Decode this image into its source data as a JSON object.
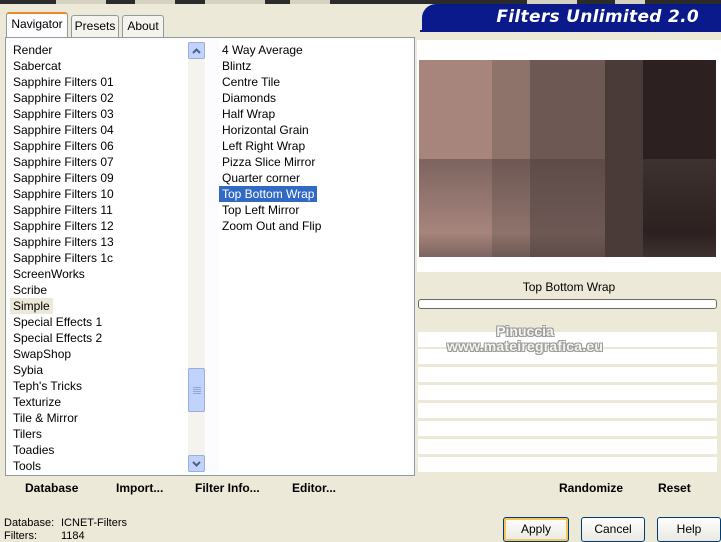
{
  "window": {
    "title": "Filters Unlimited 2.0"
  },
  "tabs": [
    {
      "label": "Navigator",
      "active": true
    },
    {
      "label": "Presets",
      "active": false
    },
    {
      "label": "About",
      "active": false
    }
  ],
  "categories": {
    "items": [
      "Render",
      "Sabercat",
      "Sapphire Filters 01",
      "Sapphire Filters 02",
      "Sapphire Filters 03",
      "Sapphire Filters 04",
      "Sapphire Filters 06",
      "Sapphire Filters 07",
      "Sapphire Filters 09",
      "Sapphire Filters 10",
      "Sapphire Filters 11",
      "Sapphire Filters 12",
      "Sapphire Filters 13",
      "Sapphire Filters 1c",
      "ScreenWorks",
      "Scribe",
      "Simple",
      "Special Effects 1",
      "Special Effects 2",
      "SwapShop",
      "Sybia",
      "Teph's Tricks",
      "Texturize",
      "Tile & Mirror",
      "Tilers",
      "Toadies",
      "Tools"
    ],
    "selected": "Simple"
  },
  "filters": {
    "items": [
      "4 Way Average",
      "Blintz",
      "Centre Tile",
      "Diamonds",
      "Half Wrap",
      "Horizontal Grain",
      "Left Right Wrap",
      "Pizza Slice Mirror",
      "Quarter corner",
      "Top Bottom Wrap",
      "Top Left Mirror",
      "Zoom Out and Flip"
    ],
    "selected": "Top Bottom Wrap"
  },
  "preview": {
    "filter_name": "Top Bottom Wrap",
    "colors": {
      "c1": "#a7857c",
      "c2": "#8e736b",
      "c3": "#6d5854",
      "c4": "#4a3a38",
      "c5": "#2c2020",
      "r2c1": "#7c6460",
      "r2c2": "#6e5854",
      "r2c3": "#5e4b48",
      "r2c4": "#4a3b39",
      "r2c5": "#3e3230"
    }
  },
  "watermark": {
    "line1": "Pinuccia",
    "line2": "www.mateiregrafica.eu"
  },
  "commands": {
    "database": "Database",
    "import": "Import...",
    "filter_info": "Filter Info...",
    "editor": "Editor...",
    "randomize": "Randomize",
    "reset": "Reset"
  },
  "status": {
    "database_label": "Database:",
    "database_value": "ICNET-Filters",
    "filters_label": "Filters:",
    "filters_value": "1184"
  },
  "buttons": {
    "apply": "Apply",
    "cancel": "Cancel",
    "help": "Help"
  },
  "theme": {
    "banner": "#0a1a8a",
    "selection": "#316ac5",
    "face": "#ece9d8"
  }
}
